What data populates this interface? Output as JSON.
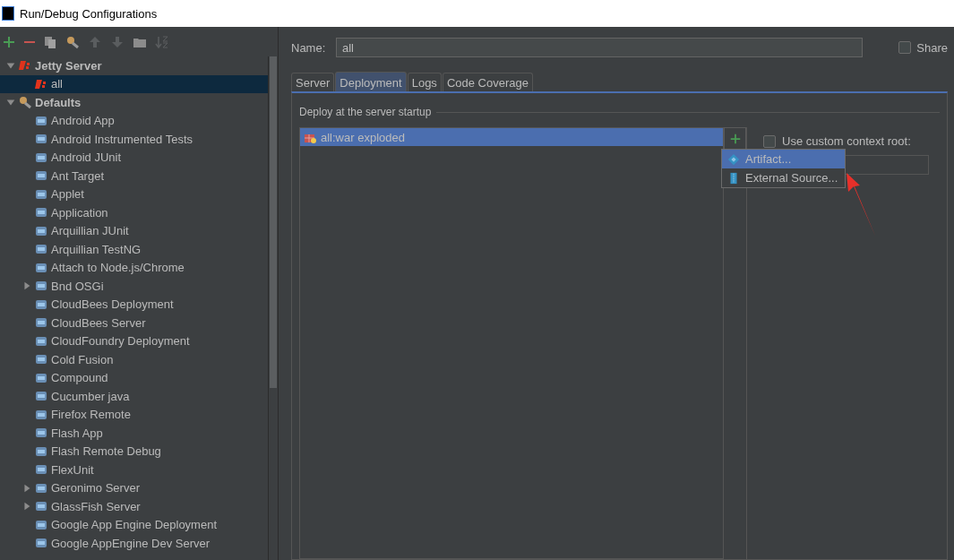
{
  "window": {
    "title": "Run/Debug Configurations"
  },
  "tree": [
    {
      "label": "Jetty Server",
      "expanded": true,
      "selected": false,
      "children": [
        {
          "label": "all",
          "selected": true
        }
      ]
    },
    {
      "label": "Defaults",
      "expanded": true,
      "selected": false,
      "children": [
        {
          "label": "Android App",
          "selected": false
        },
        {
          "label": "Android Instrumented Tests",
          "selected": false
        },
        {
          "label": "Android JUnit",
          "selected": false
        },
        {
          "label": "Ant Target",
          "selected": false
        },
        {
          "label": "Applet",
          "selected": false
        },
        {
          "label": "Application",
          "selected": false
        },
        {
          "label": "Arquillian JUnit",
          "selected": false
        },
        {
          "label": "Arquillian TestNG",
          "selected": false
        },
        {
          "label": "Attach to Node.js/Chrome",
          "selected": false
        },
        {
          "label": "Bnd OSGi",
          "selected": false,
          "expanded": false
        },
        {
          "label": "CloudBees Deployment",
          "selected": false
        },
        {
          "label": "CloudBees Server",
          "selected": false
        },
        {
          "label": "CloudFoundry Deployment",
          "selected": false
        },
        {
          "label": "Cold Fusion",
          "selected": false
        },
        {
          "label": "Compound",
          "selected": false
        },
        {
          "label": "Cucumber java",
          "selected": false
        },
        {
          "label": "Firefox Remote",
          "selected": false
        },
        {
          "label": "Flash App",
          "selected": false
        },
        {
          "label": "Flash Remote Debug",
          "selected": false
        },
        {
          "label": "FlexUnit",
          "selected": false
        },
        {
          "label": "Geronimo Server",
          "selected": false,
          "expanded": false
        },
        {
          "label": "GlassFish Server",
          "selected": false,
          "expanded": false
        },
        {
          "label": "Google App Engine Deployment",
          "selected": false
        },
        {
          "label": "Google AppEngine Dev Server",
          "selected": false
        }
      ]
    }
  ],
  "name_field": {
    "label": "Name:",
    "value": "all"
  },
  "share": {
    "label": "Share",
    "checked": false
  },
  "tabs": [
    {
      "label": "Server",
      "selected": false
    },
    {
      "label": "Deployment",
      "selected": true
    },
    {
      "label": "Logs",
      "selected": false
    },
    {
      "label": "Code Coverage",
      "selected": false
    }
  ],
  "deployment": {
    "group_title": "Deploy at the server startup",
    "artifacts": [
      {
        "label": "all:war exploded",
        "selected": true
      }
    ],
    "add_menu": [
      {
        "label": "Artifact...",
        "selected": true
      },
      {
        "label": "External Source...",
        "selected": false
      }
    ],
    "custom_context_root": {
      "label": "Use custom context root:",
      "checked": false
    }
  }
}
